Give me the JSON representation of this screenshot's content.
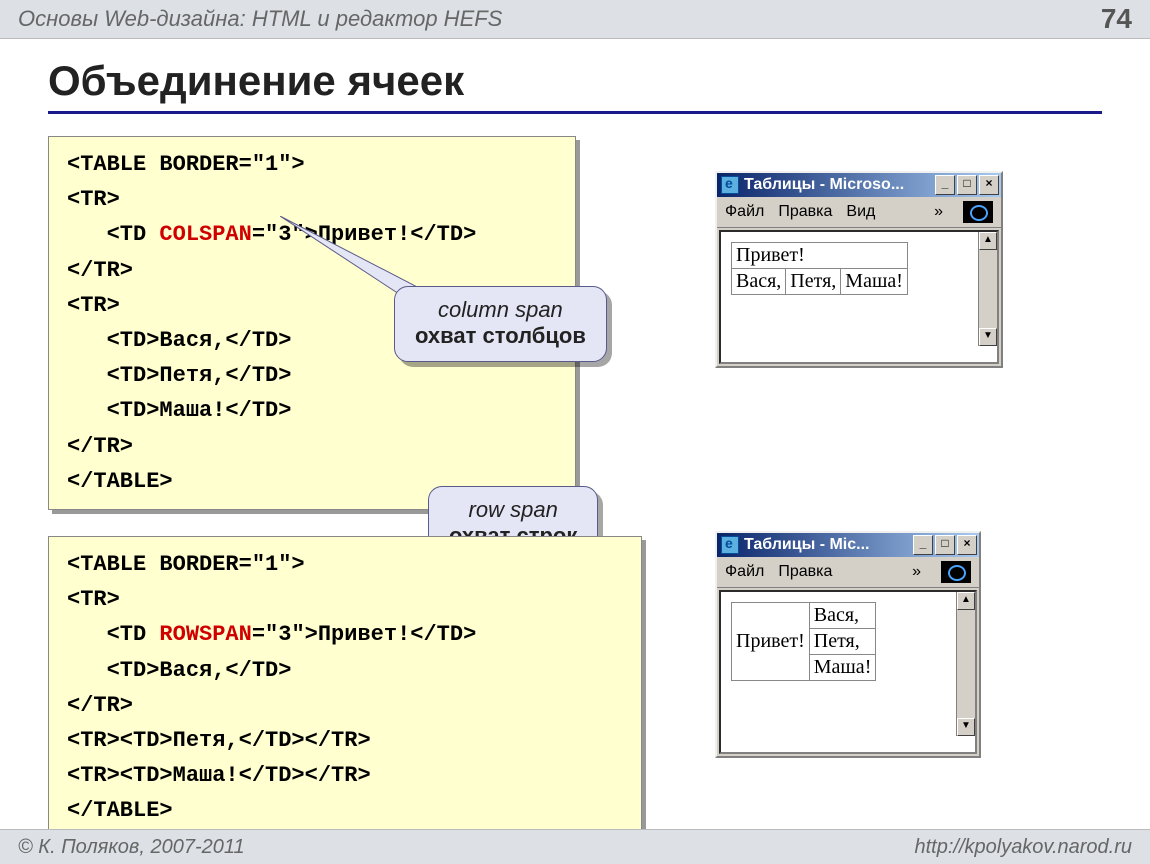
{
  "header": {
    "title": "Основы Web-дизайна: HTML и редактор HEFS",
    "page_number": "74"
  },
  "slide_title": "Объединение ячеек",
  "code1": {
    "l1": "<TABLE BORDER=\"1\">",
    "l2": "<TR>",
    "l3a": "   <TD ",
    "l3hl": "COLSPAN",
    "l3b": "=\"3\">Привет!</TD>",
    "l4": "</TR>",
    "l5": "<TR>",
    "l6": "   <TD>Вася,</TD>",
    "l7": "   <TD>Петя,</TD>",
    "l8": "   <TD>Маша!</TD>",
    "l9": "</TR>",
    "l10": "</TABLE>"
  },
  "code2": {
    "l1": "<TABLE BORDER=\"1\">",
    "l2": "<TR>",
    "l3a": "   <TD ",
    "l3hl": "ROWSPAN",
    "l3b": "=\"3\">Привет!</TD>",
    "l4": "   <TD>Вася,</TD>",
    "l5": "</TR>",
    "l6": "<TR><TD>Петя,</TD></TR>",
    "l7": "<TR><TD>Маша!</TD></TR>",
    "l8": "</TABLE>"
  },
  "callout1": {
    "line1": "column span",
    "line2": "охват столбцов"
  },
  "callout2": {
    "line1": "row span",
    "line2": "охват строк"
  },
  "browser1": {
    "title": "Таблицы - Microso...",
    "menu": {
      "file": "Файл",
      "edit": "Правка",
      "view": "Вид",
      "chev": "»"
    },
    "buttons": {
      "min": "_",
      "max": "□",
      "close": "×"
    },
    "table": {
      "r1c1": "Привет!",
      "r2c1": "Вася,",
      "r2c2": "Петя,",
      "r2c3": "Маша!"
    }
  },
  "browser2": {
    "title": "Таблицы - Mic...",
    "menu": {
      "file": "Файл",
      "edit": "Правка",
      "chev": "»"
    },
    "buttons": {
      "min": "_",
      "max": "□",
      "close": "×"
    },
    "table": {
      "c1": "Привет!",
      "r1": "Вася,",
      "r2": "Петя,",
      "r3": "Маша!"
    }
  },
  "footer": {
    "left": "© К. Поляков, 2007-2011",
    "right": "http://kpolyakov.narod.ru"
  }
}
